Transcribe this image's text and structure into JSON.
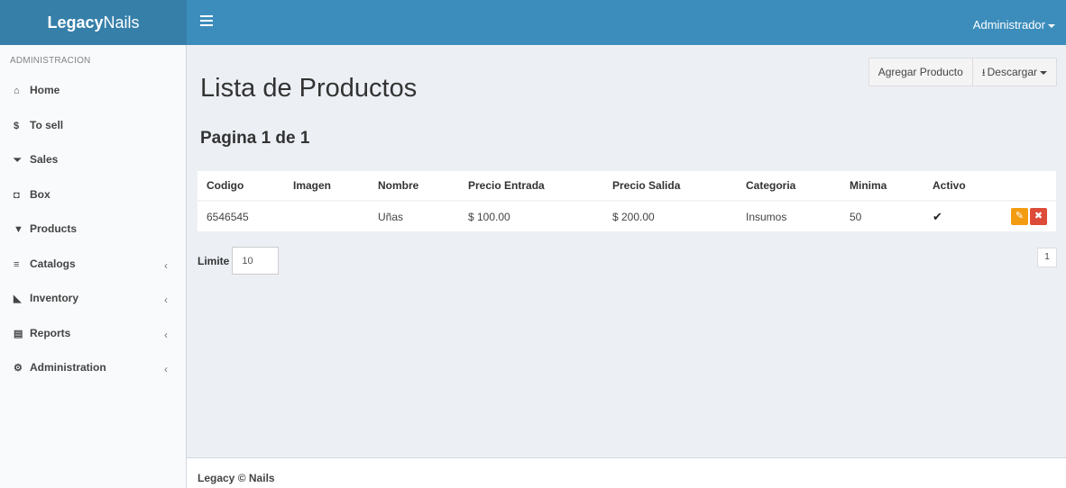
{
  "header": {
    "logo_bold": "Legacy",
    "logo_rest": "Nails",
    "user_label": "Administrador"
  },
  "sidebar": {
    "section_title": "ADMINISTRACION",
    "items": [
      {
        "label": "Home",
        "icon": "home-icon",
        "glyph": "⌂"
      },
      {
        "label": "To sell",
        "icon": "dollar-icon",
        "glyph": "$"
      },
      {
        "label": "Sales",
        "icon": "cart-icon",
        "glyph": "⏷"
      },
      {
        "label": "Box",
        "icon": "cube-icon",
        "glyph": "◘"
      },
      {
        "label": "Products",
        "icon": "filter-icon",
        "glyph": "▼"
      },
      {
        "label": "Catalogs",
        "icon": "database-icon",
        "glyph": "≡",
        "chevron": "‹"
      },
      {
        "label": "Inventory",
        "icon": "area-chart-icon",
        "glyph": "◣",
        "chevron": "‹"
      },
      {
        "label": "Reports",
        "icon": "file-text-icon",
        "glyph": "▤",
        "chevron": "‹"
      },
      {
        "label": "Administration",
        "icon": "cog-icon",
        "glyph": "⚙",
        "chevron": "‹"
      }
    ]
  },
  "main": {
    "title": "Lista de Productos",
    "subtitle": "Pagina 1 de 1",
    "add_button": "Agregar Producto",
    "download_button": "Descargar",
    "table": {
      "columns": [
        "Codigo",
        "Imagen",
        "Nombre",
        "Precio Entrada",
        "Precio Salida",
        "Categoria",
        "Minima",
        "Activo",
        ""
      ],
      "rows": [
        {
          "codigo": "6546545",
          "imagen": "",
          "nombre": "Uñas",
          "precio_entrada": "$ 100.00",
          "precio_salida": "$ 200.00",
          "categoria": "Insumos",
          "minima": "50",
          "activo": "✔"
        }
      ]
    },
    "limit_label": "Limite",
    "limit_value": "10",
    "page_number": "1"
  },
  "footer": {
    "bold": "Legacy",
    "copyright": "©",
    "rest": "Nails"
  },
  "colors": {
    "header": "#3c8dbc",
    "logo_bg": "#367fa9",
    "edit": "#f39c12",
    "delete": "#dd4b39"
  }
}
